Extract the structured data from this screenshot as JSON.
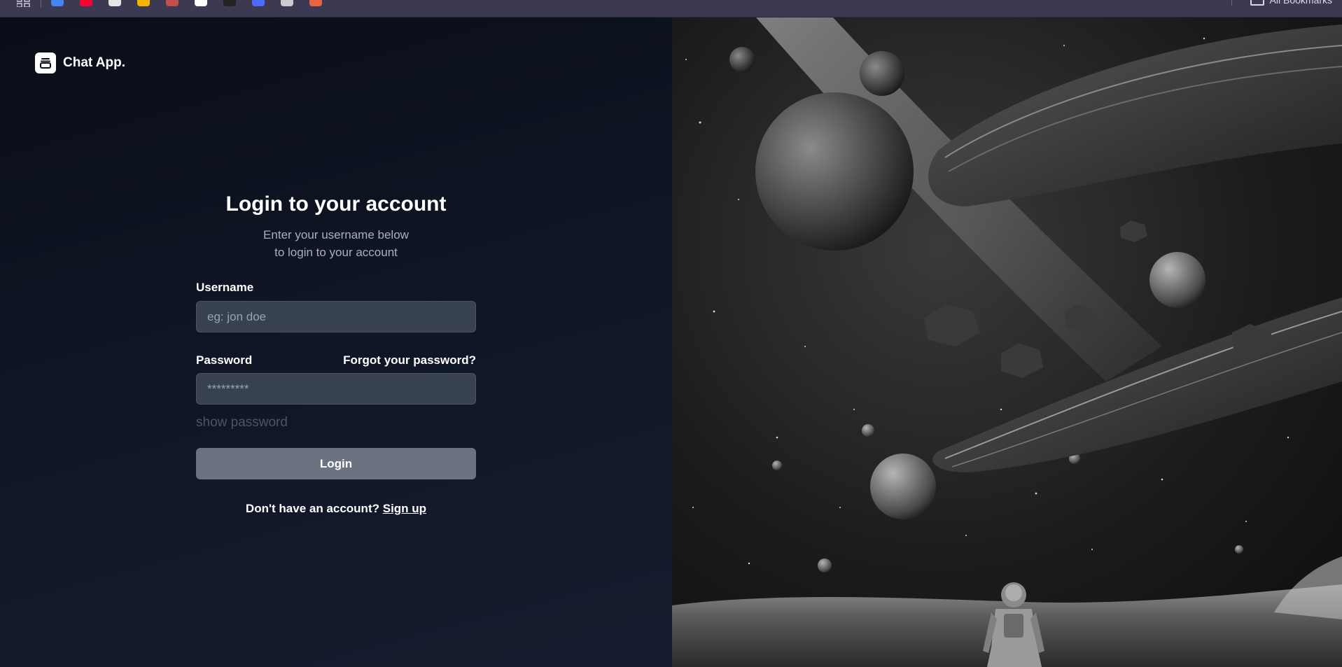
{
  "browser": {
    "bookmarks": [
      {
        "icon": "gmail-icon",
        "color": "#4285f4"
      },
      {
        "icon": "youtube-icon",
        "color": "#ff0033"
      },
      {
        "icon": "openai-icon",
        "color": "#e5e5e5"
      },
      {
        "icon": "bookmark-app-icon",
        "color": "#f4b400"
      },
      {
        "icon": "bookmark-app-icon",
        "color": "#c0504d"
      },
      {
        "icon": "github-icon",
        "color": "#ffffff"
      },
      {
        "icon": "bookmark-app-icon",
        "color": "#222222"
      },
      {
        "icon": "bookmark-app-icon",
        "color": "#4f6bff"
      },
      {
        "icon": "bookmark-app-icon",
        "color": "#cccccc"
      },
      {
        "icon": "bookmark-app-icon",
        "color": "#e8663d"
      }
    ],
    "all_bookmarks_label": "All Bookmarks"
  },
  "brand": {
    "name": "Chat App.",
    "logo_icon": "archive-box-icon"
  },
  "login": {
    "title": "Login to your account",
    "subtitle_line1": "Enter your username below",
    "subtitle_line2": "to login to your account",
    "username_label": "Username",
    "username_placeholder": "eg: jon doe",
    "username_value": "",
    "password_label": "Password",
    "forgot_password": "Forgot your password?",
    "password_placeholder": "*********",
    "password_value": "",
    "show_password": "show password",
    "login_button": "Login",
    "signup_prompt": "Don't have an account?",
    "signup_link": "Sign up"
  },
  "colors": {
    "input_bg": "#374151",
    "button_bg": "#6b7280",
    "text_muted": "#aab0bd"
  }
}
